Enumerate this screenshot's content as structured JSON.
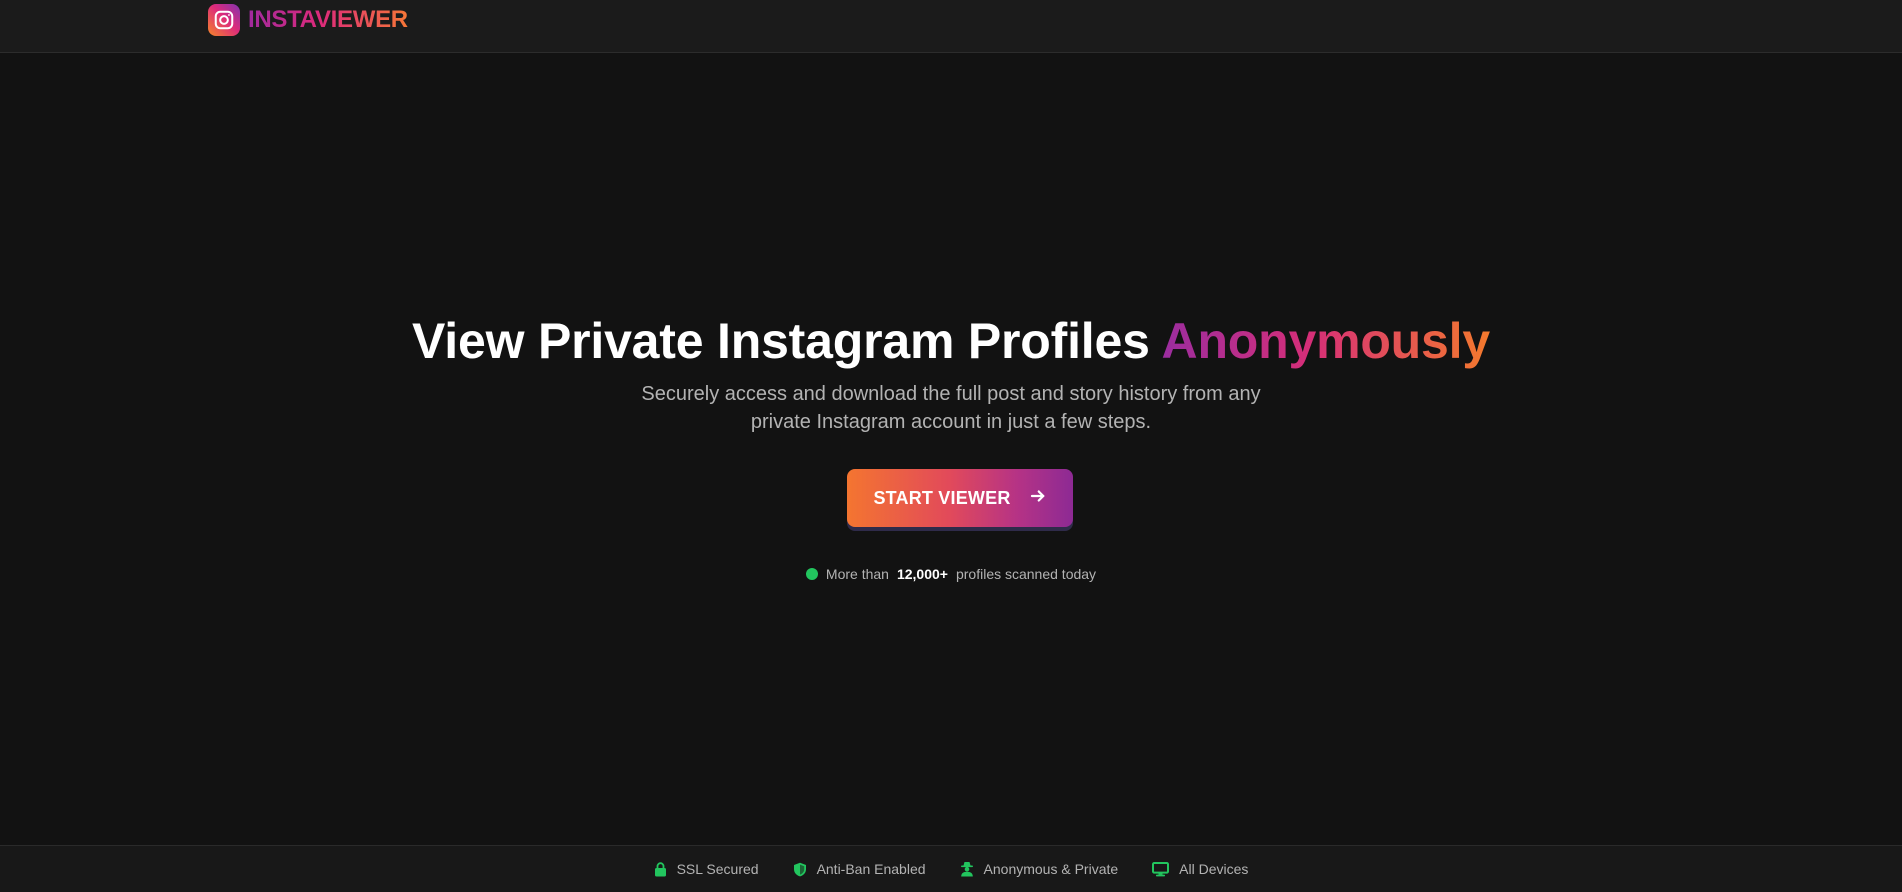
{
  "header": {
    "brand_name": "INSTAVIEWER",
    "logo_icon": "instagram-icon"
  },
  "hero": {
    "title_main": "View Private Instagram Profiles ",
    "title_accent": "Anonymously",
    "subtitle_line1": "Securely access and download the full post and story history from any",
    "subtitle_line2": "private Instagram account in just a few steps.",
    "cta_label": "START VIEWER",
    "cta_icon": "arrow-right-icon"
  },
  "stats": {
    "prefix": "More than",
    "count": "12,000+",
    "suffix": "profiles scanned today",
    "status_color": "#22c55e"
  },
  "footer": {
    "features": [
      {
        "label": "SSL Secured",
        "icon": "lock-icon"
      },
      {
        "label": "Anti-Ban Enabled",
        "icon": "shield-icon"
      },
      {
        "label": "Anonymous & Private",
        "icon": "user-secret-icon"
      },
      {
        "label": "All Devices",
        "icon": "monitor-icon"
      }
    ],
    "icon_color": "#22c55e"
  },
  "colors": {
    "background": "#121212",
    "header_background": "#1b1b1b",
    "gradient_orange": "#f47530",
    "gradient_pink": "#dd2a7b",
    "gradient_purple": "#8d2a94"
  }
}
